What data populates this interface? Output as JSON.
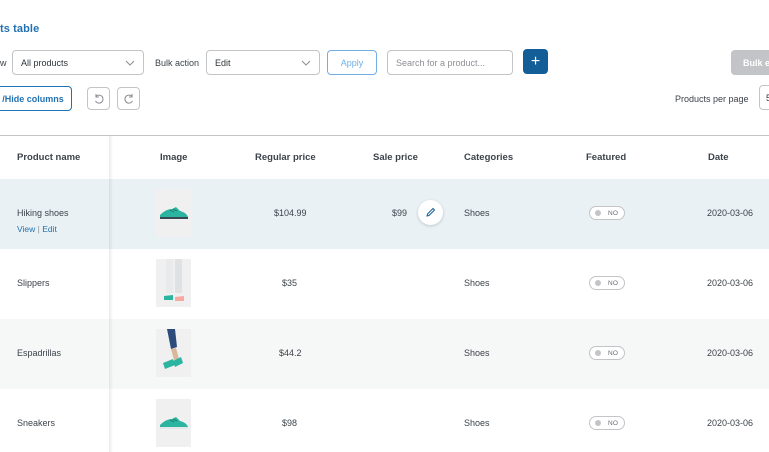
{
  "page": {
    "title": "ts table"
  },
  "toolbar": {
    "filter_label_fragment": "w",
    "filter_value": "All products",
    "bulk_action_label": "Bulk action",
    "bulk_action_value": "Edit",
    "apply_label": "Apply",
    "search_placeholder": "Search for a product...",
    "add_label": "+",
    "bulk_edit_label": "Bulk e",
    "hide_columns_label": "/Hide columns",
    "per_page_label": "Products per page",
    "per_page_value": "5"
  },
  "table": {
    "columns": [
      "Product name",
      "Image",
      "Regular price",
      "Sale price",
      "Categories",
      "Featured",
      "Date"
    ],
    "row_actions": {
      "view": "View",
      "separator": "|",
      "edit": "Edit"
    },
    "rows": [
      {
        "name": "Hiking shoes",
        "regular_price": "$104.99",
        "sale_price": "$99",
        "category": "Shoes",
        "featured": "NO",
        "date": "2020-03-06",
        "image_icon": "green-sneaker"
      },
      {
        "name": "Slippers",
        "regular_price": "$35",
        "sale_price": "",
        "category": "Shoes",
        "featured": "NO",
        "date": "2020-03-06",
        "image_icon": "legs-with-slippers"
      },
      {
        "name": "Espadrillas",
        "regular_price": "$44.2",
        "sale_price": "",
        "category": "Shoes",
        "featured": "NO",
        "date": "2020-03-06",
        "image_icon": "legs-with-espadrillas"
      },
      {
        "name": "Sneakers",
        "regular_price": "$98",
        "sale_price": "",
        "category": "Shoes",
        "featured": "NO",
        "date": "2020-03-06",
        "image_icon": "green-sneaker"
      }
    ]
  },
  "colors": {
    "accent": "#2271b1",
    "accent_dark": "#135e96",
    "hover_row": "#e9f1f5",
    "alt_row": "#f6f7f7",
    "shoe_green": "#2bb5a0"
  }
}
